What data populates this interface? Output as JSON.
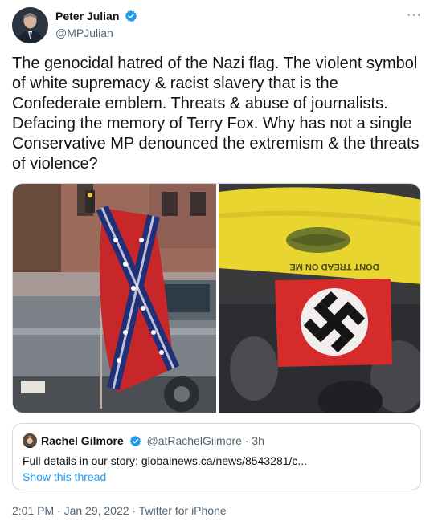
{
  "author": {
    "name": "Peter Julian",
    "handle": "@MPJulian",
    "more_label": "···"
  },
  "tweet": {
    "text": "The genocidal hatred of the Nazi flag. The violent symbol of white supremacy & racist slavery that is the Confederate emblem. Threats & abuse of journalists. Defacing the memory of Terry Fox. Why has not a single Conservative MP denounced the extremism & the threats of violence?"
  },
  "media": {
    "flag_text": "DONT TREAD ON ME"
  },
  "quote": {
    "name": "Rachel Gilmore",
    "handle_time": "@atRachelGilmore · 3h",
    "text": "Full details in our story: globalnews.ca/news/8543281/c...",
    "thread_link": "Show this thread"
  },
  "meta": {
    "timestamp": "2:01 PM · Jan 29, 2022 · Twitter for iPhone"
  },
  "colors": {
    "verified_blue": "#1d9bf0",
    "text": "#0f1419",
    "secondary": "#536471",
    "border": "#cfd9de"
  }
}
